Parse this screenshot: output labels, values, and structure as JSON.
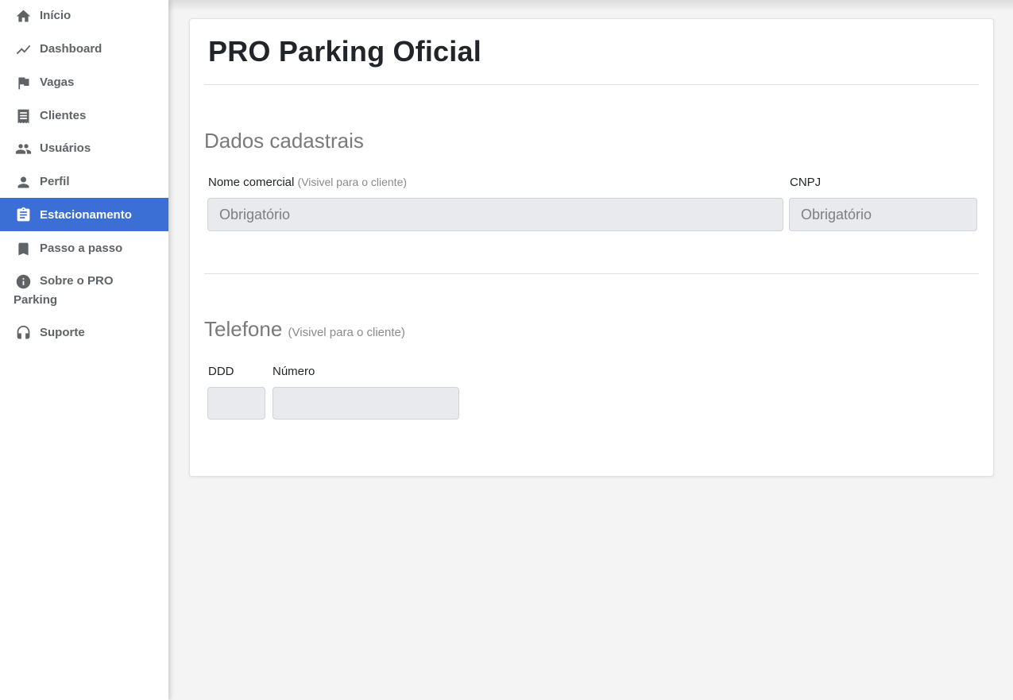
{
  "sidebar": {
    "items": [
      {
        "label": "Início",
        "icon": "home-icon"
      },
      {
        "label": "Dashboard",
        "icon": "trend-line-icon"
      },
      {
        "label": "Vagas",
        "icon": "flag-icon"
      },
      {
        "label": "Clientes",
        "icon": "receipt-icon"
      },
      {
        "label": "Usuários",
        "icon": "people-icon"
      },
      {
        "label": "Perfil",
        "icon": "person-icon"
      },
      {
        "label": "Estacionamento",
        "icon": "clipboard-icon",
        "active": true
      },
      {
        "label": "Passo a passo",
        "icon": "bookmark-icon"
      },
      {
        "label": "Sobre o PRO Parking",
        "icon": "info-icon"
      },
      {
        "label": "Suporte",
        "icon": "headset-icon"
      }
    ],
    "active_color": "#3c6fd6"
  },
  "main": {
    "title": "PRO Parking Oficial",
    "registration": {
      "heading": "Dados cadastrais",
      "trade_name_label": "Nome comercial",
      "trade_name_note": "(Visivel para o cliente)",
      "trade_name_placeholder": "Obrigatório",
      "trade_name_value": "",
      "cnpj_label": "CNPJ",
      "cnpj_placeholder": "Obrigatório",
      "cnpj_value": ""
    },
    "phone": {
      "heading": "Telefone",
      "heading_note": "(Visivel para o cliente)",
      "ddd_label": "DDD",
      "ddd_value": "",
      "number_label": "Número",
      "number_value": ""
    }
  }
}
